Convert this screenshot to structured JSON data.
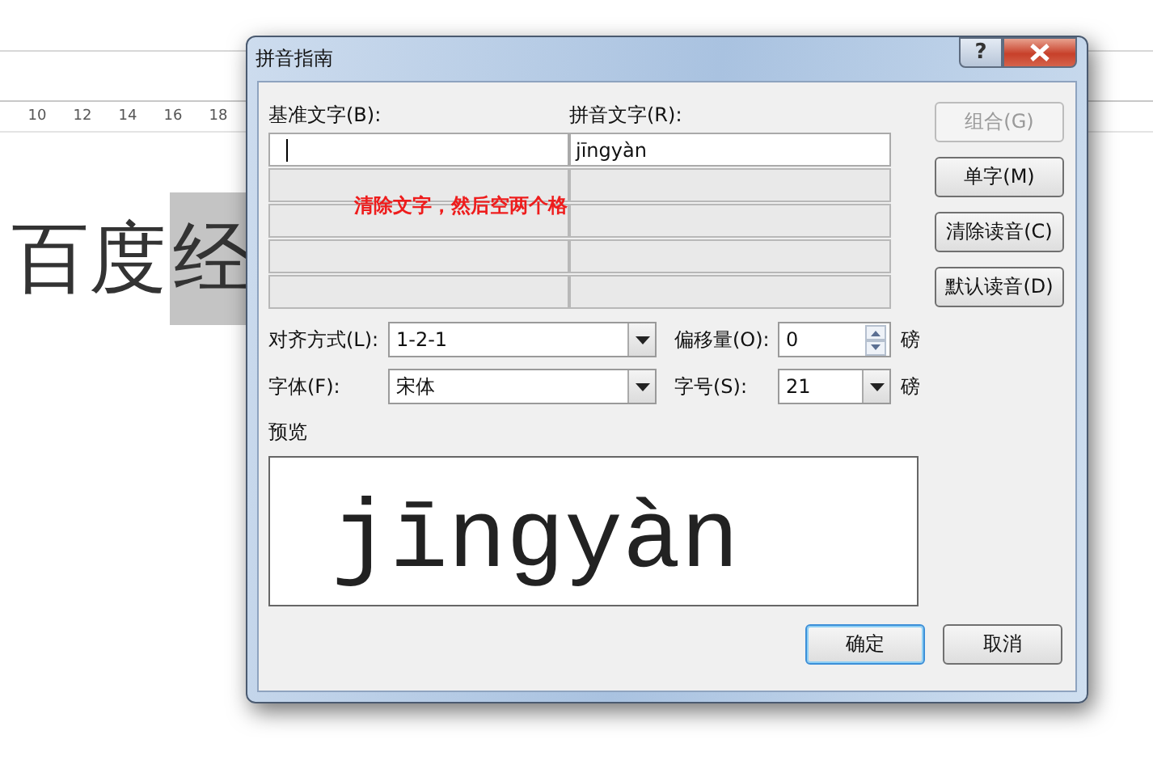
{
  "background": {
    "ruler": [
      "10",
      "12",
      "14",
      "16",
      "18"
    ],
    "document_text": [
      {
        "text": "百度",
        "highlighted": false
      },
      {
        "text": "经",
        "highlighted": true
      }
    ]
  },
  "dialog": {
    "title": "拼音指南",
    "help": "?",
    "base_label": "基准文字(B):",
    "ruby_label": "拼音文字(R):",
    "rows": [
      {
        "kind": "input",
        "pinyin": "jīngyàn"
      },
      {
        "kind": "empty"
      },
      {
        "kind": "empty"
      },
      {
        "kind": "empty"
      },
      {
        "kind": "empty"
      }
    ],
    "annotation": "清除文字，然后空两个格",
    "side_buttons": [
      {
        "label": "组合(G)",
        "disabled": true
      },
      {
        "label": "单字(M)",
        "disabled": false
      },
      {
        "label": "清除读音(C)",
        "disabled": false
      },
      {
        "label": "默认读音(D)",
        "disabled": false
      }
    ],
    "alignment": {
      "label": "对齐方式(L):",
      "value": "1-2-1"
    },
    "offset": {
      "label": "偏移量(O):",
      "value": "0",
      "unit": "磅"
    },
    "font": {
      "label": "字体(F):",
      "value": "宋体"
    },
    "size": {
      "label": "字号(S):",
      "value": "21",
      "unit": "磅"
    },
    "preview_label": "预览",
    "preview_text": "jīngyàn",
    "buttons": [
      {
        "label": "确定",
        "default": true
      },
      {
        "label": "取消",
        "default": false
      }
    ]
  }
}
